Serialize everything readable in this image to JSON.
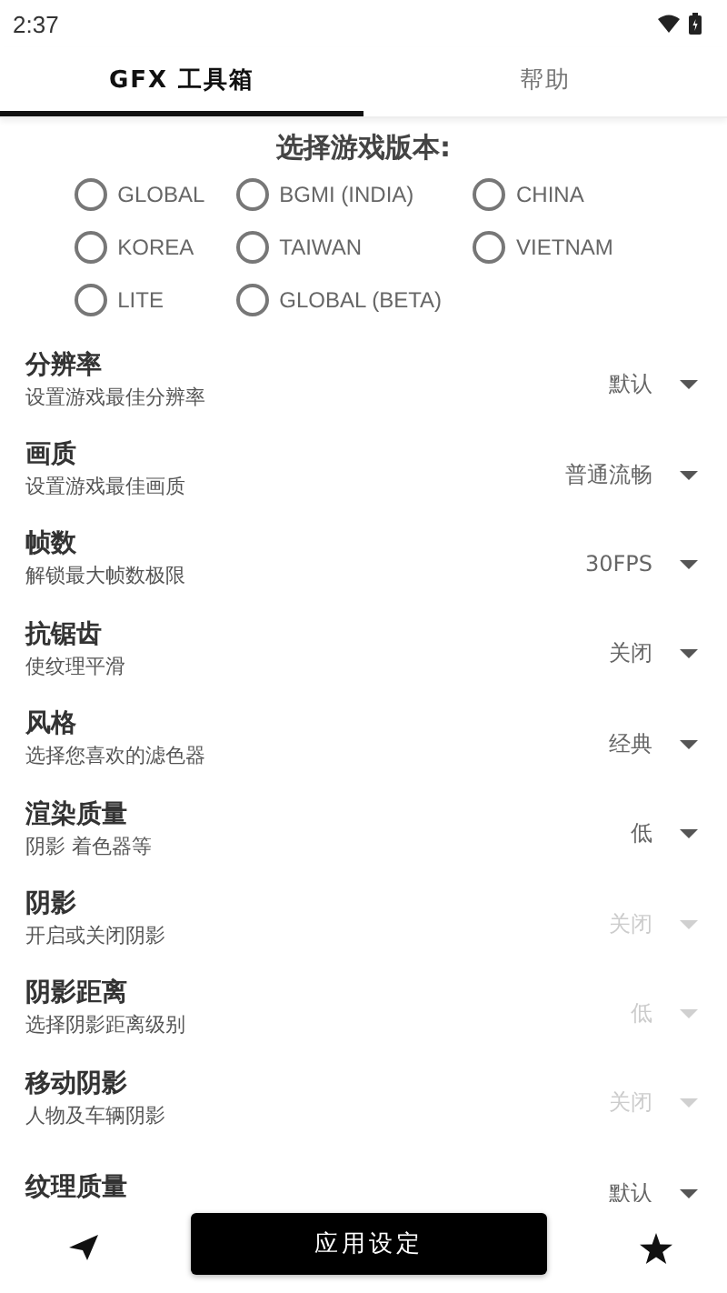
{
  "status_bar": {
    "time": "2:37"
  },
  "tabs": [
    {
      "label": "GFX 工具箱",
      "selected": true
    },
    {
      "label": "帮助",
      "selected": false
    }
  ],
  "version_picker": {
    "title": "选择游戏版本:",
    "options": [
      {
        "label": "GLOBAL",
        "selected": false
      },
      {
        "label": "BGMI (INDIA)",
        "selected": false
      },
      {
        "label": "CHINA",
        "selected": false
      },
      {
        "label": "KOREA",
        "selected": false
      },
      {
        "label": "TAIWAN",
        "selected": false
      },
      {
        "label": "VIETNAM",
        "selected": false
      },
      {
        "label": "LITE",
        "selected": false
      },
      {
        "label": "GLOBAL (BETA)",
        "selected": false
      }
    ]
  },
  "settings": [
    {
      "title": "分辨率",
      "subtitle": "设置游戏最佳分辨率",
      "value": "默认",
      "disabled": false
    },
    {
      "title": "画质",
      "subtitle": "设置游戏最佳画质",
      "value": "普通流畅",
      "disabled": false
    },
    {
      "title": "帧数",
      "subtitle": "解锁最大帧数极限",
      "value": "30FPS",
      "disabled": false
    },
    {
      "title": "抗锯齿",
      "subtitle": "使纹理平滑",
      "value": "关闭",
      "disabled": false
    },
    {
      "title": "风格",
      "subtitle": "选择您喜欢的滤色器",
      "value": "经典",
      "disabled": false
    },
    {
      "title": "渲染质量",
      "subtitle": "阴影 着色器等",
      "value": "低",
      "disabled": false
    },
    {
      "title": "阴影",
      "subtitle": "开启或关闭阴影",
      "value": "关闭",
      "disabled": true
    },
    {
      "title": "阴影距离",
      "subtitle": "选择阴影距离级别",
      "value": "低",
      "disabled": true
    },
    {
      "title": "移动阴影",
      "subtitle": "人物及车辆阴影",
      "value": "关闭",
      "disabled": true
    },
    {
      "title": "纹理质量",
      "value": "默认",
      "disabled": false
    }
  ],
  "bottom_bar": {
    "apply_button": "应用设定"
  }
}
